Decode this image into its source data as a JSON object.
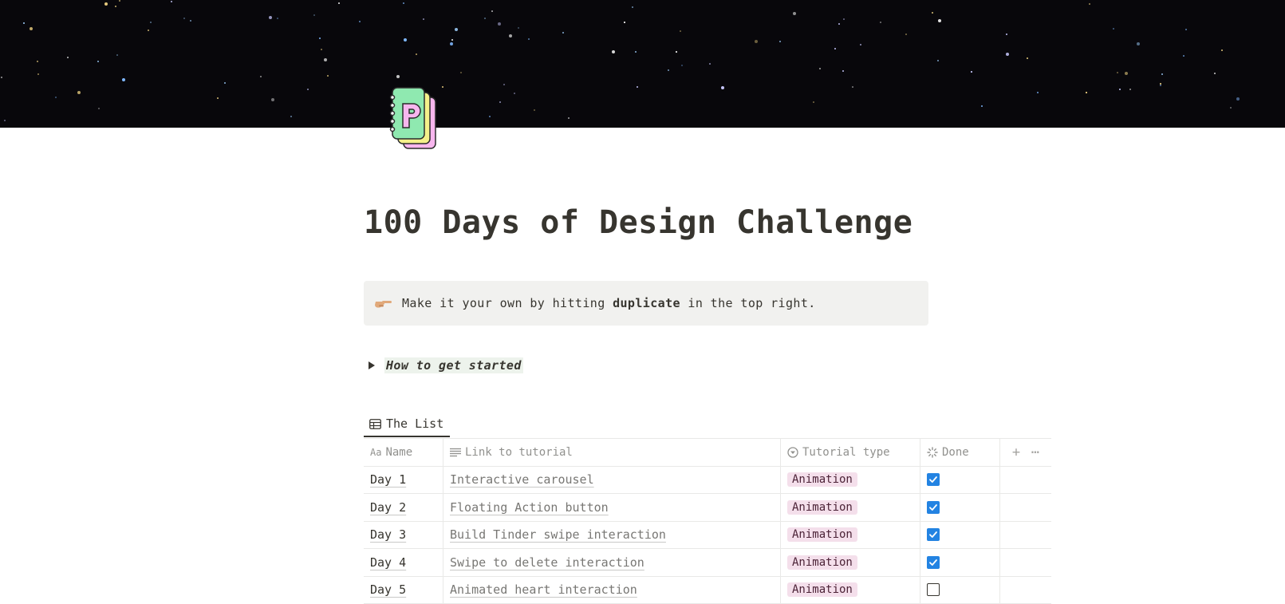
{
  "page": {
    "title": "100 Days of Design Challenge",
    "icon": "spiral-notebook-p-icon"
  },
  "callout": {
    "icon": "pointing-hand-icon",
    "text_before": "Make it your own by hitting ",
    "text_bold": "duplicate",
    "text_after": " in the top right."
  },
  "toggle": {
    "label": "How to get started",
    "state": "collapsed"
  },
  "view": {
    "tab_label": "The List",
    "tab_icon": "table-icon"
  },
  "table": {
    "headers": {
      "name": "Name",
      "name_icon": "Aa",
      "link": "Link to tutorial",
      "type": "Tutorial type",
      "done": "Done"
    },
    "rows": [
      {
        "name": "Day 1",
        "link": "Interactive carousel",
        "type": "Animation",
        "done": true
      },
      {
        "name": "Day 2",
        "link": "Floating Action button",
        "type": "Animation",
        "done": true
      },
      {
        "name": "Day 3",
        "link": "Build Tinder swipe interaction",
        "type": "Animation",
        "done": true
      },
      {
        "name": "Day 4",
        "link": "Swipe to delete interaction",
        "type": "Animation",
        "done": true
      },
      {
        "name": "Day 5",
        "link": "Animated heart interaction",
        "type": "Animation",
        "done": false
      }
    ]
  },
  "colors": {
    "cover_bg": "#08070b",
    "checkbox_checked": "#2383e2",
    "tag_bg": "#f4dfeb",
    "tag_text": "#4c2337",
    "callout_bg": "#f1f1ef",
    "toggle_highlight": "#edf3ec"
  }
}
